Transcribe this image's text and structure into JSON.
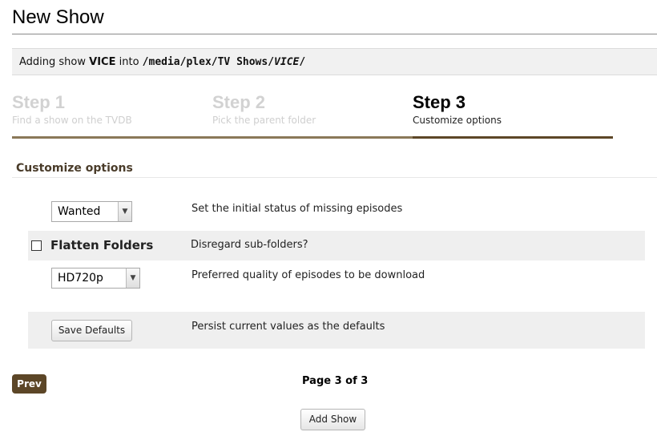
{
  "page": {
    "title": "New Show"
  },
  "info_bar": {
    "prefix": "Adding show",
    "show_name": "VICE",
    "into_text": "into",
    "path_base": "/media/plex/TV Shows/",
    "path_show": "VICE",
    "path_suffix": "/"
  },
  "steps": [
    {
      "number": "Step 1",
      "description": "Find a show on the TVDB",
      "state": "inactive"
    },
    {
      "number": "Step 2",
      "description": "Pick the parent folder",
      "state": "inactive"
    },
    {
      "number": "Step 3",
      "description": "Customize options",
      "state": "active"
    }
  ],
  "colors": {
    "step_bar_inactive": "#8a7858",
    "step_bar_active": "#5c4627",
    "accent_brown": "#5c4627"
  },
  "section": {
    "title": "Customize options"
  },
  "options": {
    "status_select": {
      "value": "Wanted",
      "description": "Set the initial status of missing episodes"
    },
    "flatten_folders": {
      "label": "Flatten Folders",
      "checked": false,
      "description": "Disregard sub-folders?"
    },
    "quality_select": {
      "value": "HD720p",
      "description": "Preferred quality of episodes to be download"
    },
    "save_defaults": {
      "label": "Save Defaults",
      "description": "Persist current values as the defaults"
    }
  },
  "footer": {
    "prev_label": "Prev",
    "page_indicator": "Page 3 of 3",
    "add_show_label": "Add Show"
  }
}
